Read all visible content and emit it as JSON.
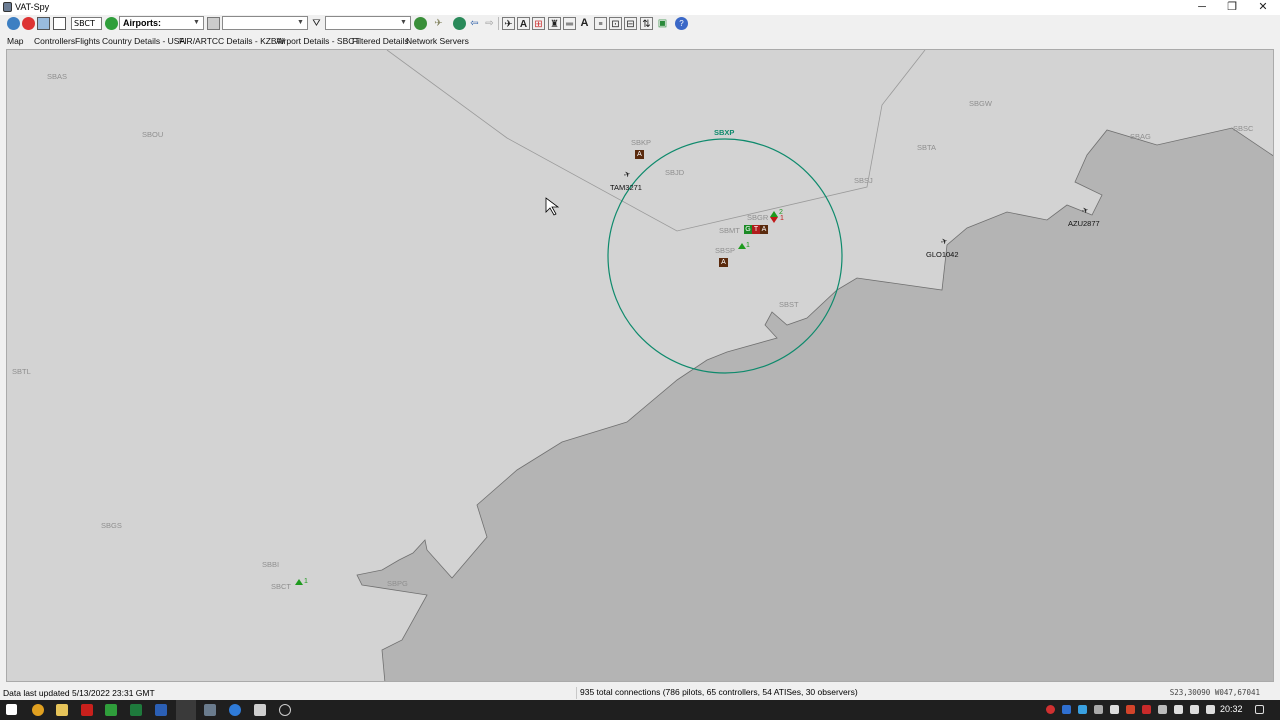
{
  "window": {
    "title": "VAT-Spy",
    "minimize": "─",
    "maximize": "❐",
    "close": "✕"
  },
  "toolbar": {
    "id_input_value": "SBCT",
    "filter_select": "Airports:",
    "combo2": "",
    "combo3": "",
    "icons": [
      "connect-icon",
      "disconnect-icon",
      "refresh-icon",
      "settings-icon",
      "go-icon",
      "filter-icon",
      "planes-icon",
      "globe-icon",
      "back-icon",
      "forward-icon",
      "aircraft-icon",
      "label-a-icon",
      "grid-icon",
      "tower-icon",
      "runway-icon",
      "label-a2-icon",
      "flight-level-icon",
      "vor-icon",
      "ndb-icon",
      "sector-icon",
      "help-icon"
    ]
  },
  "tabs": [
    "Map",
    "Controllers",
    "Flights",
    "Country Details - USA",
    "FIR/ARTCC Details - KZBW",
    "Airport Details - SBCT",
    "Filtered Details",
    "Network Servers"
  ],
  "map": {
    "colors": {
      "sea": "#d3d3d3",
      "land": "#b4b4b4",
      "coast": "#707070",
      "boundary": "#9a9a9a",
      "approach_circle": "#0e8a6c"
    },
    "airports": [
      "SBAS",
      "SBOU",
      "SBTL",
      "SBGS",
      "SBBI",
      "SBCT",
      "SBPG",
      "SBKP",
      "SBJD",
      "SBMT",
      "SBGR",
      "SBSP",
      "SBST",
      "SBSJ",
      "SBTA",
      "SBGW",
      "SBAG",
      "SBSC",
      "SBXP"
    ],
    "approach_label": "SBXP",
    "controller_badges": [
      "G",
      "T",
      "A"
    ],
    "counts": {
      "sbgr_arrivals": "2",
      "sbgr_departures": "1",
      "sbsp": "1",
      "sbct": "1"
    },
    "flights": [
      "TAM3271",
      "GLO1042",
      "AZU2877"
    ],
    "atis_label": "A"
  },
  "status": {
    "updated": "Data last updated 5/13/2022 23:31 GMT",
    "connections": "935 total connections (786 pilots, 65 controllers, 54 ATISes, 30 observers)",
    "coords": "S23,30090  W047,67041"
  },
  "taskbar": {
    "clock": "20:32"
  }
}
